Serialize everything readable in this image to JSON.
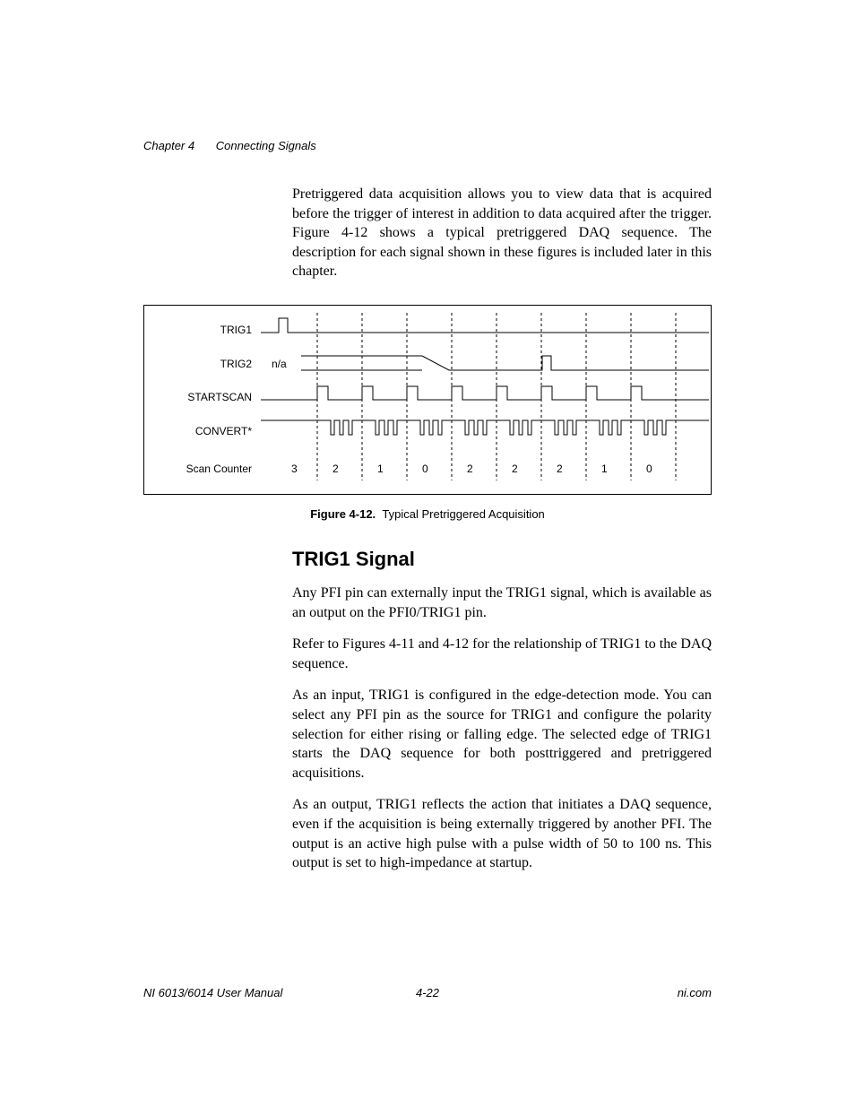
{
  "header": {
    "chapter_num": "Chapter 4",
    "chapter_title": "Connecting Signals"
  },
  "intro": "Pretriggered data acquisition allows you to view data that is acquired before the trigger of interest in addition to data acquired after the trigger. Figure 4-12 shows a typical pretriggered DAQ sequence. The description for each signal shown in these figures is included later in this chapter.",
  "figure": {
    "signals": {
      "trig1": "TRIG1",
      "trig2": "TRIG2",
      "startscan": "STARTSCAN",
      "convert": "CONVERT*",
      "scan_counter": "Scan Counter",
      "na": "n/a"
    },
    "scan_counter_values": [
      "3",
      "2",
      "1",
      "0",
      "2",
      "2",
      "2",
      "1",
      "0"
    ],
    "caption_bold": "Figure 4-12.",
    "caption_rest": "Typical Pretriggered Acquisition"
  },
  "section": {
    "heading": "TRIG1 Signal",
    "p1": "Any PFI pin can externally input the TRIG1 signal, which is available as an output on the PFI0/TRIG1 pin.",
    "p2": "Refer to Figures 4-11 and 4-12 for the relationship of TRIG1 to the DAQ sequence.",
    "p3": "As an input, TRIG1 is configured in the edge-detection mode. You can select any PFI pin as the source for TRIG1 and configure the polarity selection for either rising or falling edge. The selected edge of TRIG1 starts the DAQ sequence for both posttriggered and pretriggered acquisitions.",
    "p4": "As an output, TRIG1 reflects the action that initiates a DAQ sequence, even if the acquisition is being externally triggered by another PFI. The output is an active high pulse with a pulse width of 50 to 100 ns. This output is set to high-impedance at startup."
  },
  "footer": {
    "left": "NI 6013/6014 User Manual",
    "center": "4-22",
    "right": "ni.com"
  },
  "chart_data": {
    "type": "timing-diagram",
    "title": "Typical Pretriggered Acquisition",
    "signals": [
      {
        "name": "TRIG1",
        "description": "single high pulse near start",
        "pulses": [
          {
            "t": 1,
            "width": 0.2
          }
        ]
      },
      {
        "name": "TRIG2",
        "description": "n/a (don't-care) until mid-sequence, then low with one high pulse",
        "pulses": [
          {
            "t": 6.6,
            "width": 0.2
          }
        ],
        "dont_care_until": 4.5
      },
      {
        "name": "STARTSCAN",
        "description": "periodic high pulses, one per scan",
        "pulses": [
          {
            "t": 2
          },
          {
            "t": 3
          },
          {
            "t": 4
          },
          {
            "t": 5
          },
          {
            "t": 6
          },
          {
            "t": 7
          },
          {
            "t": 8
          },
          {
            "t": 9
          }
        ],
        "pulse_width": 0.25
      },
      {
        "name": "CONVERT*",
        "description": "groups of three narrow low-going pulses after each STARTSCAN",
        "groups": 8,
        "pulses_per_group": 3
      },
      {
        "name": "Scan Counter",
        "values": [
          "3",
          "2",
          "1",
          "0",
          "2",
          "2",
          "2",
          "1",
          "0"
        ]
      }
    ],
    "time_divisions": 9
  }
}
